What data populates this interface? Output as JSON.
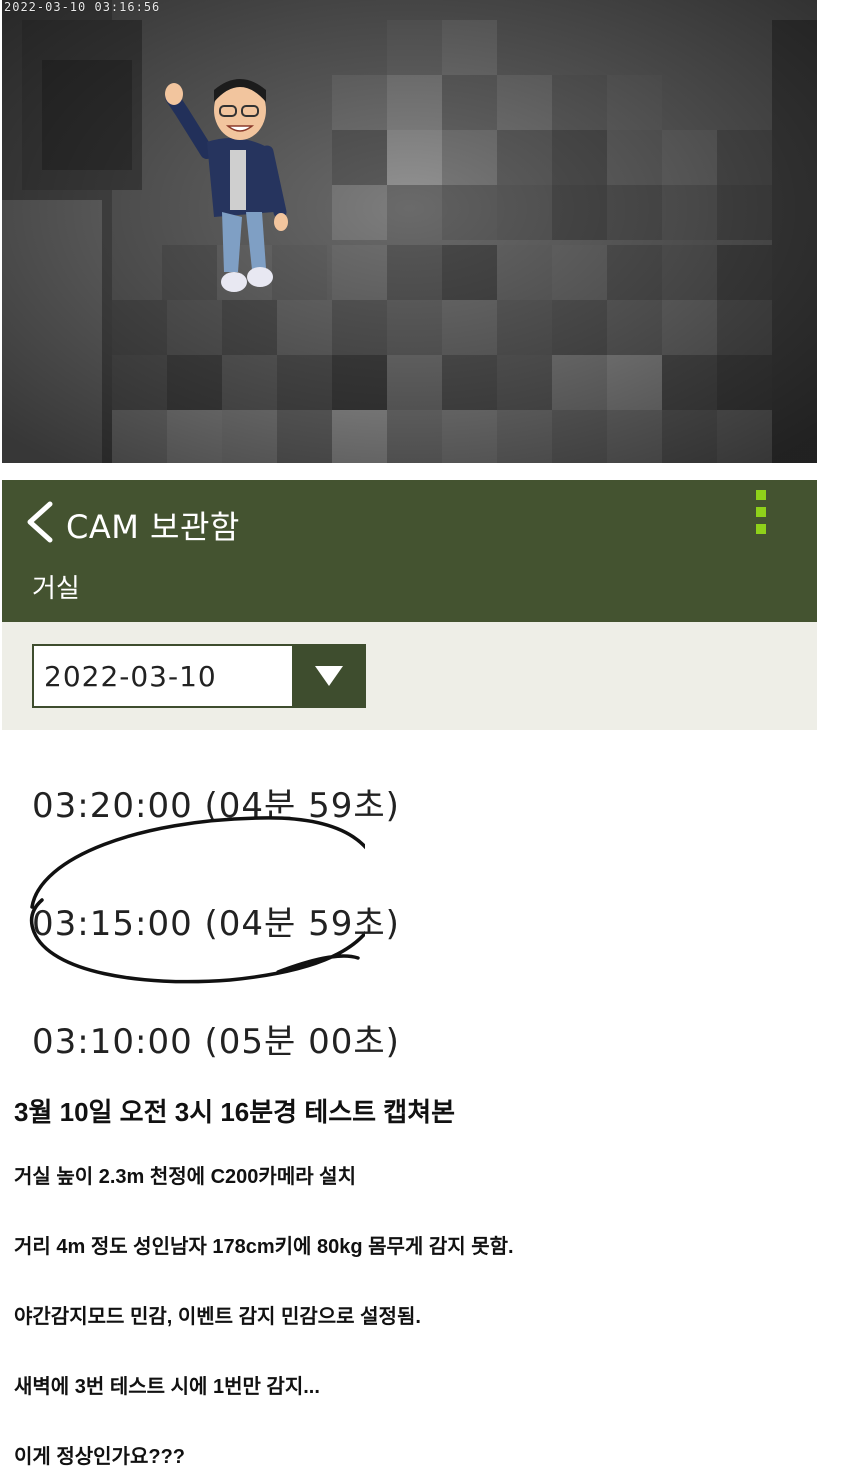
{
  "camera": {
    "timestamp": "2022-03-10 03:16:56"
  },
  "header": {
    "back_icon": "chevron-left-icon",
    "title": "CAM 보관함",
    "subtitle": "거실",
    "menu_icon": "more-vertical-icon",
    "bg_color": "#445330",
    "accent_color": "#8fd11a"
  },
  "date_picker": {
    "value": "2022-03-10",
    "icon": "triangle-down-icon"
  },
  "recordings": [
    {
      "label": "03:20:00 (04분 59초)"
    },
    {
      "label": "03:15:00 (04분 59초)"
    },
    {
      "label": "03:10:00 (05분 00초)"
    }
  ],
  "post": {
    "heading": "3월 10일 오전 3시 16분경 테스트 캡쳐본",
    "lines": [
      "거실 높이 2.3m 천정에 C200카메라 설치",
      "거리 4m 정도 성인남자 178cm키에 80kg 몸무게 감지 못함.",
      "야간감지모드 민감, 이벤트 감지 민감으로 설정됨.",
      "새벽에 3번 테스트 시에 1번만 감지...",
      "이게 정상인가요???"
    ]
  }
}
